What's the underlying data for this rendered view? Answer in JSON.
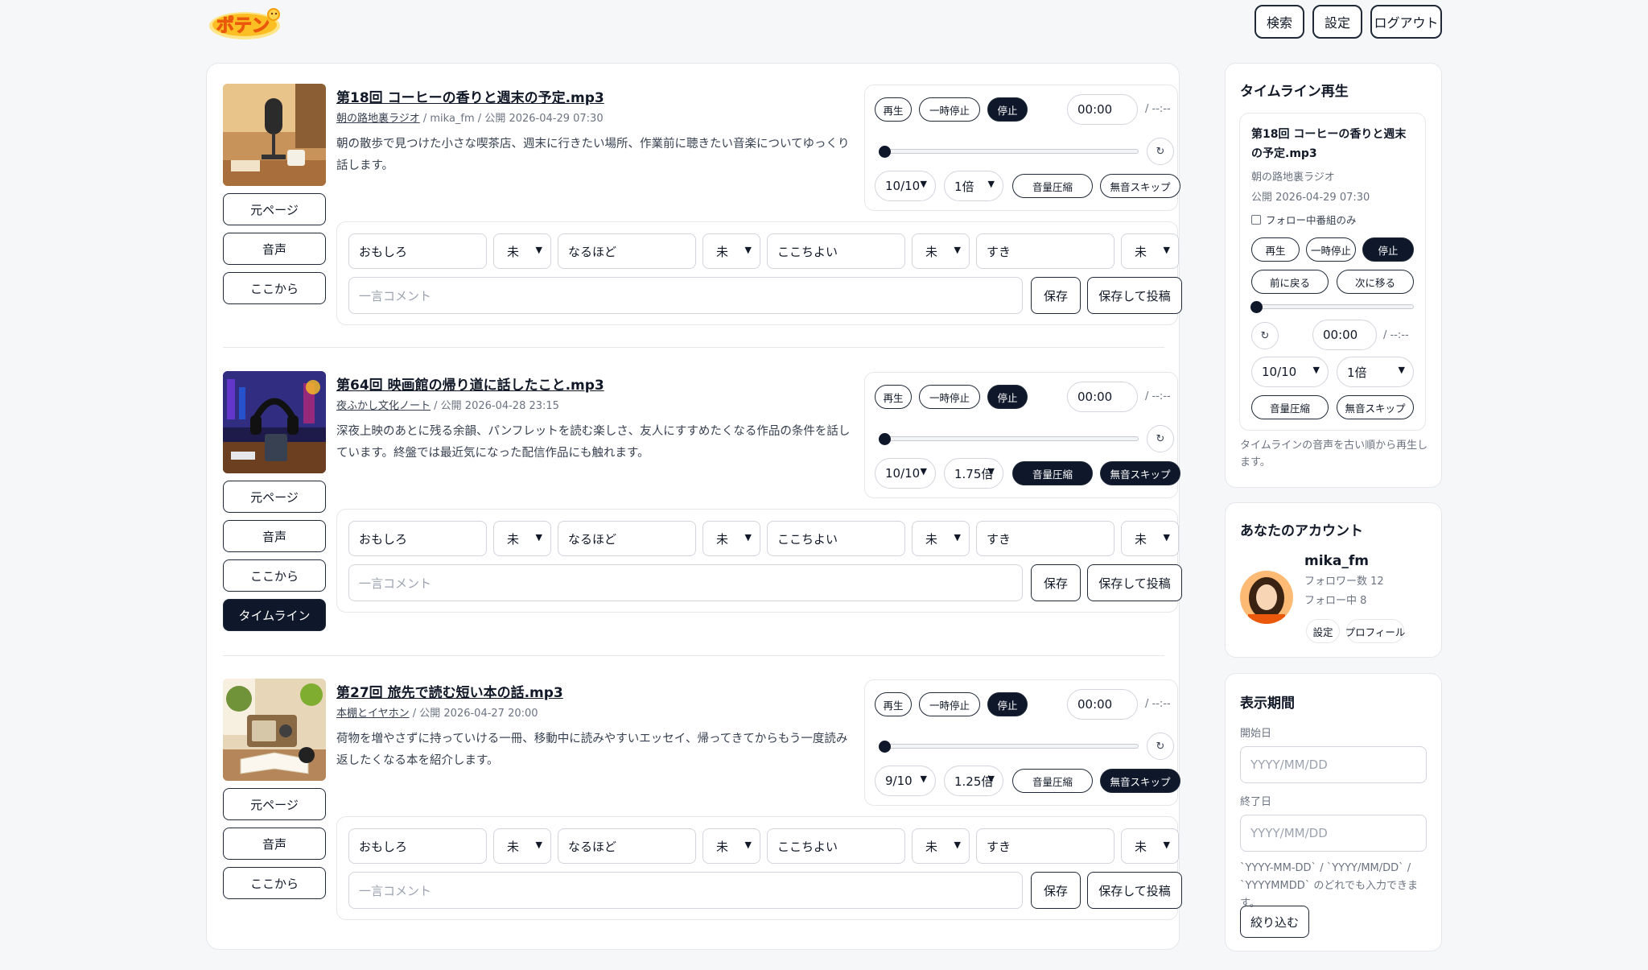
{
  "header": {
    "logo_text": "ポテン",
    "search_label": "検索",
    "settings_label": "設定",
    "logout_label": "ログアウト"
  },
  "common": {
    "play": "再生",
    "pause": "一時停止",
    "stop": "停止",
    "time_current": "00:00",
    "time_total": "/ --:--",
    "reload_icon": "↻",
    "compress": "音量圧縮",
    "silence_skip": "無音スキップ",
    "source_page": "元ページ",
    "audio": "音声",
    "from_here": "ここから",
    "timeline": "タイムライン",
    "rating_labels": [
      "おもしろ",
      "なるほど",
      "ここちよい",
      "すき"
    ],
    "rating_unset": "未",
    "comment_placeholder": "一言コメント",
    "save": "保存",
    "save_and_post": "保存して投稿"
  },
  "episodes": [
    {
      "title": "第18回 コーヒーの香りと週末の予定.mp3",
      "program": "朝の路地裏ラジオ",
      "meta_rest": " / mika_fm / 公開 2026-04-29 07:30",
      "description": "朝の散歩で見つけた小さな喫茶店、週末に行きたい場所、作業前に聴きたい音楽についてゆっくり話します。",
      "volume": "10/10",
      "speed": "1倍",
      "compress_on": false,
      "skip_on": false
    },
    {
      "title": "第64回 映画館の帰り道に話したこと.mp3",
      "program": "夜ふかし文化ノート",
      "meta_rest": " / 公開 2026-04-28 23:15",
      "description": "深夜上映のあとに残る余韻、パンフレットを読む楽しさ、友人にすすめたくなる作品の条件を話しています。終盤では最近気になった配信作品にも触れます。",
      "volume": "10/10",
      "speed": "1.75倍",
      "compress_on": true,
      "skip_on": true
    },
    {
      "title": "第27回 旅先で読む短い本の話.mp3",
      "program": "本棚とイヤホン",
      "meta_rest": " / 公開 2026-04-27 20:00",
      "description": "荷物を増やさずに持っていける一冊、移動中に読みやすいエッセイ、帰ってきてからもう一度読み返したくなる本を紹介します。",
      "volume": "9/10",
      "speed": "1.25倍",
      "compress_on": false,
      "skip_on": true
    }
  ],
  "timeline": {
    "heading": "タイムライン再生",
    "now_title": "第18回 コーヒーの香りと週末の予定.mp3",
    "now_program": "朝の路地裏ラジオ",
    "now_date": "公開 2026-04-29 07:30",
    "follow_only": "フォロー中番組のみ",
    "prev": "前に戻る",
    "next": "次に移る",
    "volume": "10/10",
    "speed": "1倍",
    "note": "タイムラインの音声を古い順から再生します。"
  },
  "account": {
    "heading": "あなたのアカウント",
    "username": "mika_fm",
    "followers": "フォロワー数 12",
    "following": "フォロー中 8",
    "settings": "設定",
    "profile": "プロフィール"
  },
  "period": {
    "heading": "表示期間",
    "start_label": "開始日",
    "end_label": "終了日",
    "placeholder": "YYYY/MM/DD",
    "hint": "`YYYY-MM-DD` / `YYYY/MM/DD` / `YYYYMMDD` のどれでも入力できます。",
    "filter": "絞り込む"
  },
  "colors": {
    "accent_dark": "#0f172a",
    "logo_orange": "#f59e0b"
  }
}
